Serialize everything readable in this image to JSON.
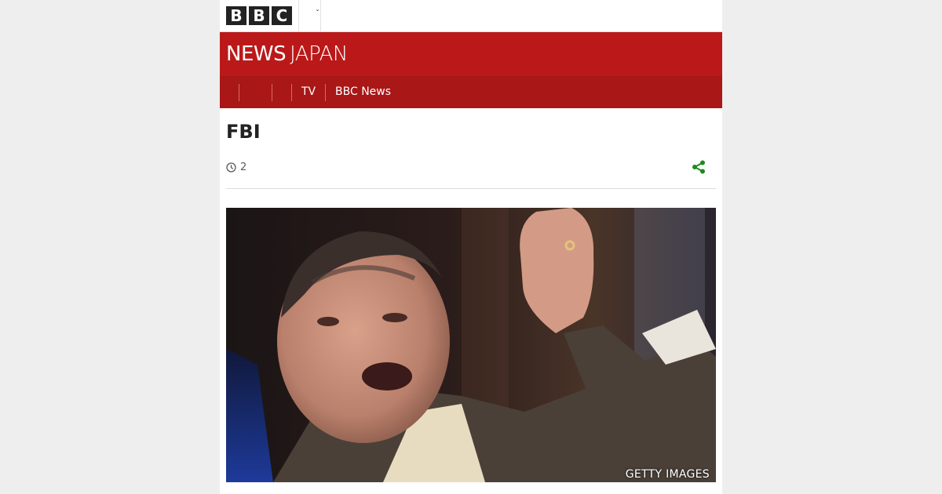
{
  "header": {
    "logo_letters": [
      "B",
      "B",
      "C"
    ],
    "language_menu_icon": "chevron-down-icon"
  },
  "masthead": {
    "brand_news": "NEWS",
    "brand_region": "JAPAN",
    "background": "#bb1919"
  },
  "nav": {
    "items": [
      {
        "label": ""
      },
      {
        "label": ""
      },
      {
        "label": ""
      },
      {
        "label": "TV"
      },
      {
        "label": "BBC News"
      }
    ],
    "background": "#a91717"
  },
  "article": {
    "headline": "FBI",
    "timestamp": "2",
    "timestamp_icon": "clock-icon",
    "share_icon": "share-icon",
    "share_color": "#1e8a1e",
    "image_credit": "GETTY IMAGES"
  }
}
